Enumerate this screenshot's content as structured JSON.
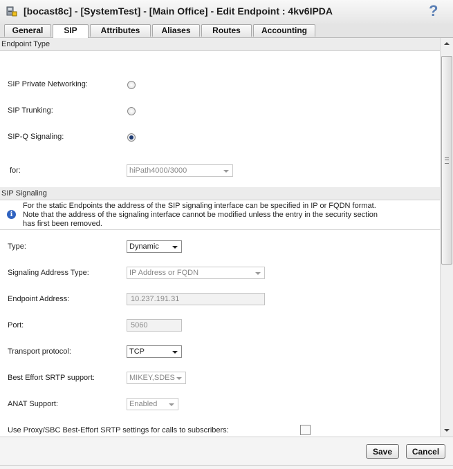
{
  "window": {
    "title": "[bocast8c] - [SystemTest] - [Main Office] - Edit Endpoint : 4kv6IPDA",
    "help": "?"
  },
  "tabs": [
    {
      "label": "General",
      "active": false
    },
    {
      "label": "SIP",
      "active": true
    },
    {
      "label": "Attributes",
      "active": false
    },
    {
      "label": "Aliases",
      "active": false
    },
    {
      "label": "Routes",
      "active": false
    },
    {
      "label": "Accounting",
      "active": false
    }
  ],
  "endpoint_type": {
    "header": "Endpoint Type",
    "options": [
      {
        "label": "SIP Private Networking:",
        "selected": false
      },
      {
        "label": "SIP Trunking:",
        "selected": false
      },
      {
        "label": "SIP-Q Signaling:",
        "selected": true
      }
    ],
    "for_label": "for:",
    "for_value": "hiPath4000/3000"
  },
  "sip_signaling": {
    "header": "SIP Signaling",
    "info_lines": [
      "For the static Endpoints the address of the SIP signaling interface can be specified in IP or FQDN format.",
      "Note that the address of the signaling interface cannot be modified unless the entry in the security section",
      "has first been removed."
    ],
    "type_label": "Type:",
    "type_value": "Dynamic",
    "address_type_label": "Signaling Address Type:",
    "address_type_value": "IP Address or FQDN",
    "endpoint_address_label": "Endpoint Address:",
    "endpoint_address_value": "10.237.191.31",
    "port_label": "Port:",
    "port_value": "5060",
    "transport_label": "Transport protocol:",
    "transport_value": "TCP",
    "srtp_label": "Best Effort SRTP support:",
    "srtp_value": "MIKEY,SDES",
    "anat_label": "ANAT Support:",
    "anat_value": "Enabled",
    "proxy_label": "Use Proxy/SBC Best-Effort SRTP settings for calls to subscribers:",
    "proxy_checked": false
  },
  "footer": {
    "save_label": "Save",
    "cancel_label": "Cancel"
  },
  "icons": {
    "app": "endpoint-app-icon",
    "help": "help-question-icon",
    "info": "info-icon"
  },
  "colors": {
    "accent": "#2f62c0",
    "help": "#5a7fb5",
    "section_header": "#ececec"
  }
}
